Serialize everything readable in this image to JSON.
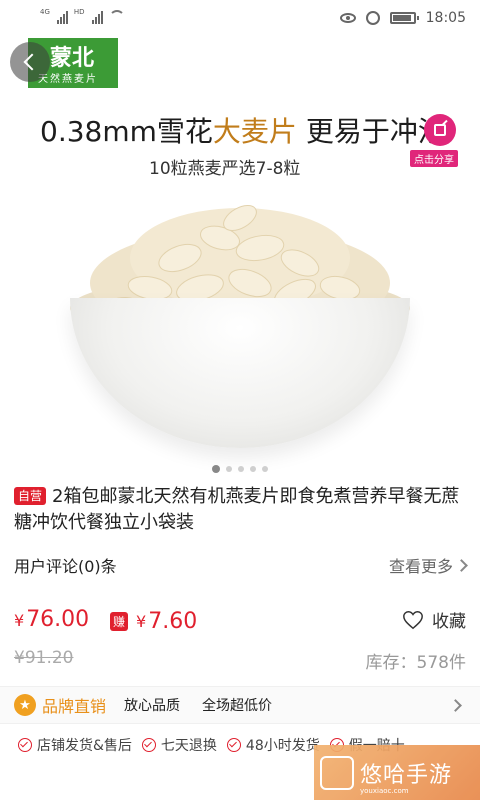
{
  "status_bar": {
    "sim1_tag": "4G",
    "sim2_tag": "HD",
    "time": "18:05"
  },
  "hero": {
    "brand_name": "蒙北",
    "brand_slogan": "天然燕麦片",
    "headline_prefix": "0.38mm",
    "headline_normal1": "雪花",
    "headline_highlight": "大麦片",
    "headline_normal2": " 更易于冲泡",
    "subline": "10粒燕麦严选7-8粒",
    "share_label": "点击分享",
    "carousel_count": 5,
    "carousel_active": 0
  },
  "product": {
    "self_badge": "自营",
    "title": "2箱包邮蒙北天然有机燕麦片即食免煮营养早餐无蔗糖冲饮代餐独立小袋装",
    "reviews_label": "用户评论(0)条",
    "view_more": "查看更多",
    "price_symbol": "¥",
    "price": "76.00",
    "earn_tag": "赚",
    "earn_amount": "7.60",
    "favorite_label": "收藏",
    "original_price": "¥91.20",
    "stock": "库存：578件"
  },
  "brand_bar": {
    "label": "品牌直销",
    "features": [
      "放心品质",
      "全场超低价"
    ]
  },
  "services": [
    "店铺发货&售后",
    "七天退换",
    "48小时发货",
    "假一赔十"
  ],
  "watermark": {
    "text": "悠哈手游",
    "sub": "youxiaoc.com"
  },
  "colors": {
    "accent_red": "#e0202e",
    "brand_green": "#3c9b36",
    "share_pink": "#e0267a",
    "orange": "#e8901a"
  }
}
